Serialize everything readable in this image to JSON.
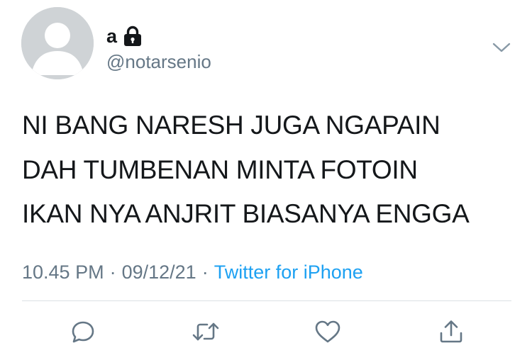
{
  "tweet": {
    "display_name": "a",
    "handle": "@notarsenio",
    "text_lines": [
      "NI BANG NARESH JUGA NGAPAIN",
      "DAH TUMBENAN MINTA FOTOIN",
      "IKAN NYA ANJRIT BIASANYA ENGGA"
    ],
    "time": "10.45 PM",
    "date": "09/12/21",
    "separator": "·",
    "source": "Twitter for iPhone"
  },
  "icons": {
    "avatar": "default-avatar-icon",
    "protected": "lock-icon",
    "menu": "chevron-down-icon",
    "reply": "reply-icon",
    "retweet": "retweet-icon",
    "like": "heart-icon",
    "share": "share-icon"
  },
  "colors": {
    "text": "#14171a",
    "secondary": "#657786",
    "link": "#1da1f2",
    "avatar_bg": "#cfd3d6",
    "divider": "#dbe0e4"
  }
}
